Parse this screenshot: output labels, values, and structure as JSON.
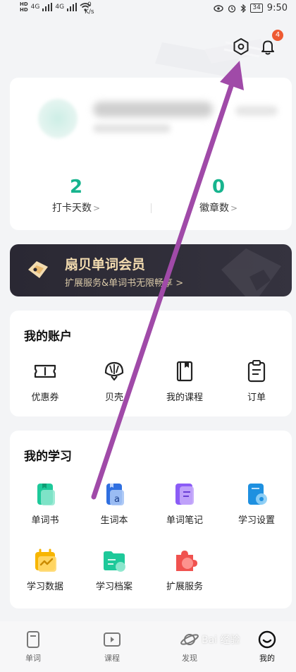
{
  "status_bar": {
    "network_1": "4G",
    "network_2": "4G",
    "hd": "HD",
    "speed_value": "0",
    "speed_unit": "K/s",
    "battery": "34",
    "time": "9:50"
  },
  "header": {
    "notification_count": "4"
  },
  "profile": {
    "stats": [
      {
        "value": "2",
        "label": "打卡天数"
      },
      {
        "value": "0",
        "label": "徽章数"
      }
    ]
  },
  "member": {
    "title": "扇贝单词会员",
    "subtitle": "扩展服务&单词书无限畅享"
  },
  "account": {
    "title": "我的账户",
    "items": [
      {
        "label": "优惠券"
      },
      {
        "label": "贝壳"
      },
      {
        "label": "我的课程"
      },
      {
        "label": "订单"
      }
    ]
  },
  "study": {
    "title": "我的学习",
    "items": [
      {
        "label": "单词书"
      },
      {
        "label": "生词本"
      },
      {
        "label": "单词笔记"
      },
      {
        "label": "学习设置"
      },
      {
        "label": "学习数据"
      },
      {
        "label": "学习档案"
      },
      {
        "label": "扩展服务"
      }
    ]
  },
  "nav": {
    "items": [
      {
        "label": "单词"
      },
      {
        "label": "课程"
      },
      {
        "label": "发现"
      },
      {
        "label": "我的"
      }
    ]
  },
  "watermark": "Bai 经验",
  "colors": {
    "accent_green": "#17b48e",
    "member_gold": "#f3dcb0",
    "badge_red": "#ee5a32",
    "arrow_purple": "#a04aa8"
  }
}
